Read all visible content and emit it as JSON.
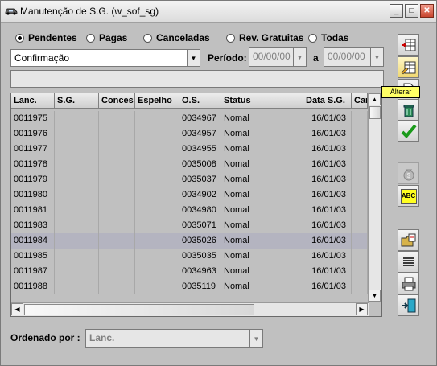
{
  "window": {
    "title": "Manutenção de S.G. (w_sof_sg)",
    "icon": "car-icon",
    "buttons": [
      "minimize",
      "maximize",
      "close"
    ]
  },
  "filters": {
    "options": [
      {
        "label": "Pendentes",
        "selected": true
      },
      {
        "label": "Pagas",
        "selected": false
      },
      {
        "label": "Canceladas",
        "selected": false
      },
      {
        "label": "Rev. Gratuitas",
        "selected": false
      },
      {
        "label": "Todas",
        "selected": false
      }
    ],
    "status_combo": "Confirmação",
    "periodo_label": "Período:",
    "periodo_from": "00/00/00",
    "a_label": "a",
    "periodo_to": "00/00/00",
    "info_text": ""
  },
  "table": {
    "columns": [
      "Lanc.",
      "S.G.",
      "Conces.",
      "Espelho",
      "O.S.",
      "Status",
      "Data S.G.",
      "Can"
    ],
    "rows": [
      [
        "0011975",
        "",
        "",
        "",
        "0034967",
        "Nomal",
        "16/01/03",
        ""
      ],
      [
        "0011976",
        "",
        "",
        "",
        "0034957",
        "Nomal",
        "16/01/03",
        ""
      ],
      [
        "0011977",
        "",
        "",
        "",
        "0034955",
        "Nomal",
        "16/01/03",
        ""
      ],
      [
        "0011978",
        "",
        "",
        "",
        "0035008",
        "Nomal",
        "16/01/03",
        ""
      ],
      [
        "0011979",
        "",
        "",
        "",
        "0035037",
        "Nomal",
        "16/01/03",
        ""
      ],
      [
        "0011980",
        "",
        "",
        "",
        "0034902",
        "Nomal",
        "16/01/03",
        ""
      ],
      [
        "0011981",
        "",
        "",
        "",
        "0034980",
        "Nomal",
        "16/01/03",
        ""
      ],
      [
        "0011983",
        "",
        "",
        "",
        "0035071",
        "Nomal",
        "16/01/03",
        ""
      ],
      [
        "0011984",
        "",
        "",
        "",
        "0035026",
        "Nomal",
        "16/01/03",
        ""
      ],
      [
        "0011985",
        "",
        "",
        "",
        "0035035",
        "Nomal",
        "16/01/03",
        ""
      ],
      [
        "0011987",
        "",
        "",
        "",
        "0034963",
        "Nomal",
        "16/01/03",
        ""
      ],
      [
        "0011988",
        "",
        "",
        "",
        "0035119",
        "Nomal",
        "16/01/03",
        ""
      ]
    ],
    "selected_row_index": 8
  },
  "toolbar": {
    "tooltip": "Alterar",
    "buttons": [
      {
        "name": "insert-row-icon"
      },
      {
        "name": "edit-table-icon"
      },
      {
        "name": "document-icon"
      },
      {
        "name": "trash-icon"
      },
      {
        "name": "checkmark-icon"
      },
      {
        "name": "money-bag-icon"
      },
      {
        "name": "spellcheck-icon",
        "text": "ABC"
      },
      {
        "name": "open-folder-icon"
      },
      {
        "name": "align-text-icon"
      },
      {
        "name": "printer-icon"
      },
      {
        "name": "exit-door-icon"
      }
    ]
  },
  "footer": {
    "order_label": "Ordenado por :",
    "order_value": "Lanc."
  },
  "colors": {
    "window_bg": "#c0c0c0",
    "selected_row": "#b4b4c0",
    "tooltip_bg": "#ffff66",
    "check_green": "#1a9a1a"
  }
}
